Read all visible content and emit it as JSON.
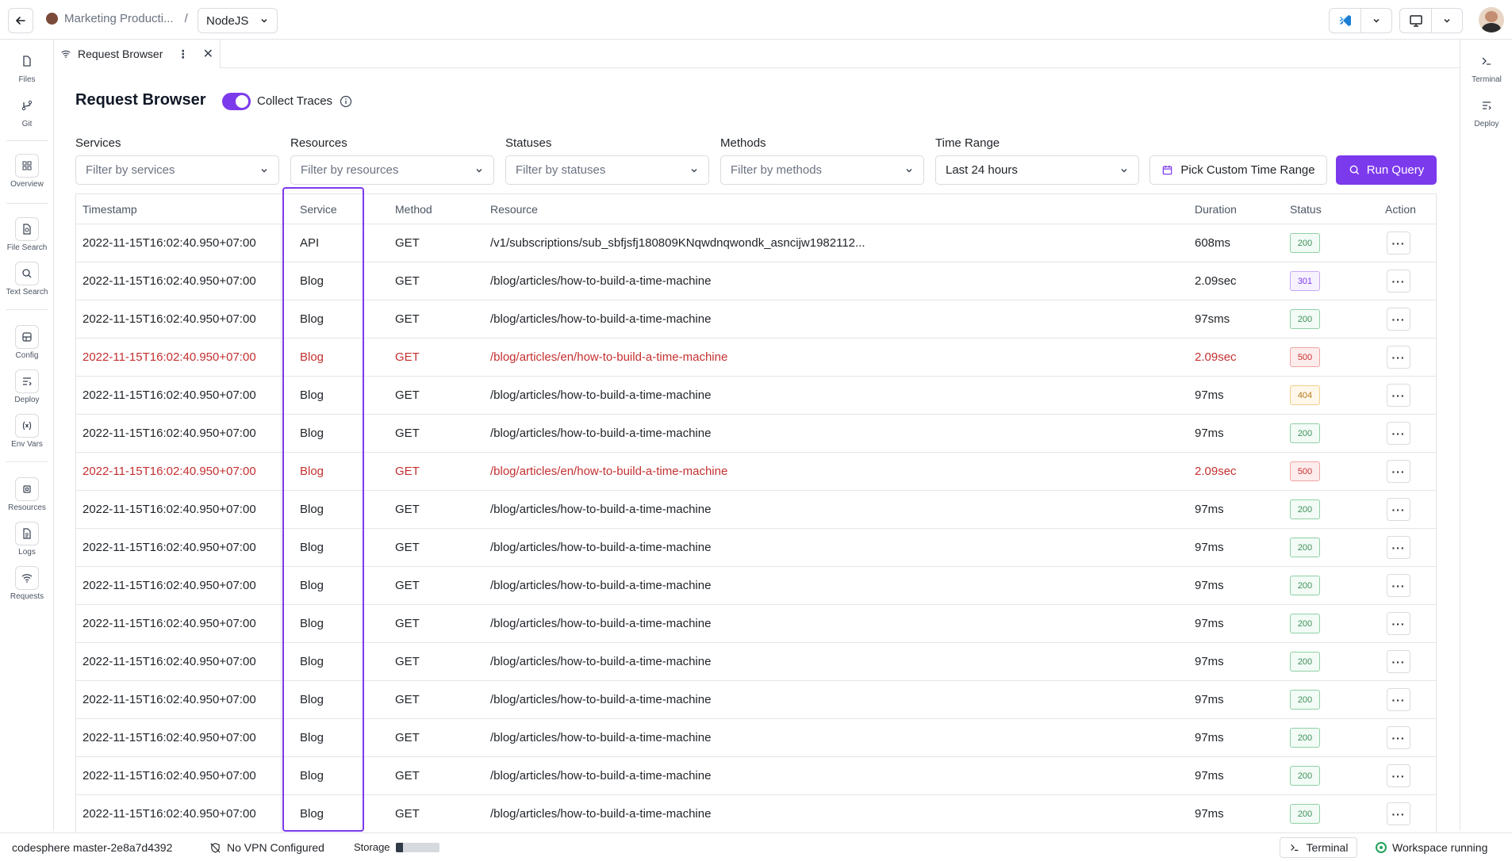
{
  "topbar": {
    "project": "Marketing Producti...",
    "separator": "/",
    "runtime": "NodeJS"
  },
  "left_sidebar": {
    "items": [
      {
        "label": "Files",
        "icon": "file-icon"
      },
      {
        "label": "Git",
        "icon": "git-branch-icon"
      },
      {
        "label": "Overview",
        "icon": "grid-icon"
      },
      {
        "label": "File Search",
        "icon": "file-search-icon"
      },
      {
        "label": "Text Search",
        "icon": "text-search-icon"
      },
      {
        "label": "Config",
        "icon": "config-icon"
      },
      {
        "label": "Deploy",
        "icon": "deploy-icon"
      },
      {
        "label": "Env Vars",
        "icon": "env-vars-icon"
      },
      {
        "label": "Resources",
        "icon": "chip-icon"
      },
      {
        "label": "Logs",
        "icon": "logs-icon"
      },
      {
        "label": "Requests",
        "icon": "wifi-icon"
      }
    ]
  },
  "right_sidebar": {
    "items": [
      {
        "label": "Terminal",
        "icon": "terminal-icon"
      },
      {
        "label": "Deploy",
        "icon": "deploy-icon"
      }
    ]
  },
  "tab": {
    "label": "Request Browser",
    "menu": "⋮",
    "close": "✕"
  },
  "header": {
    "title": "Request Browser",
    "collect_traces_label": "Collect Traces",
    "collect_traces_on": true
  },
  "filters": {
    "services": {
      "label": "Services",
      "placeholder": "Filter by services"
    },
    "resources": {
      "label": "Resources",
      "placeholder": "Filter by resources"
    },
    "statuses": {
      "label": "Statuses",
      "placeholder": "Filter by statuses"
    },
    "methods": {
      "label": "Methods",
      "placeholder": "Filter by methods"
    },
    "time_range": {
      "label": "Time Range",
      "value": "Last 24 hours"
    },
    "custom_range_button": "Pick Custom Time Range",
    "run_query_button": "Run Query"
  },
  "table": {
    "columns": [
      "Timestamp",
      "Service",
      "Method",
      "Resource",
      "Duration",
      "Status",
      "Action"
    ],
    "rows": [
      {
        "timestamp": "2022-11-15T16:02:40.950+07:00",
        "service": "API",
        "method": "GET",
        "resource": "/v1/subscriptions/sub_sbfjsfj180809KNqwdnqwondk_asncijw1982112...",
        "duration": "608ms",
        "status": "200",
        "kind": "ok",
        "action": "···"
      },
      {
        "timestamp": "2022-11-15T16:02:40.950+07:00",
        "service": "Blog",
        "method": "GET",
        "resource": "/blog/articles/how-to-build-a-time-machine",
        "duration": "2.09sec",
        "status": "301",
        "kind": "redir",
        "action": "···"
      },
      {
        "timestamp": "2022-11-15T16:02:40.950+07:00",
        "service": "Blog",
        "method": "GET",
        "resource": "/blog/articles/how-to-build-a-time-machine",
        "duration": "97sms",
        "status": "200",
        "kind": "ok",
        "action": "···"
      },
      {
        "timestamp": "2022-11-15T16:02:40.950+07:00",
        "service": "Blog",
        "method": "GET",
        "resource": "/blog/articles/en/how-to-build-a-time-machine",
        "duration": "2.09sec",
        "status": "500",
        "kind": "err",
        "action": "···"
      },
      {
        "timestamp": "2022-11-15T16:02:40.950+07:00",
        "service": "Blog",
        "method": "GET",
        "resource": "/blog/articles/how-to-build-a-time-machine",
        "duration": "97ms",
        "status": "404",
        "kind": "warn",
        "action": "···"
      },
      {
        "timestamp": "2022-11-15T16:02:40.950+07:00",
        "service": "Blog",
        "method": "GET",
        "resource": "/blog/articles/how-to-build-a-time-machine",
        "duration": "97ms",
        "status": "200",
        "kind": "ok",
        "action": "···"
      },
      {
        "timestamp": "2022-11-15T16:02:40.950+07:00",
        "service": "Blog",
        "method": "GET",
        "resource": "/blog/articles/en/how-to-build-a-time-machine",
        "duration": "2.09sec",
        "status": "500",
        "kind": "err",
        "action": "···"
      },
      {
        "timestamp": "2022-11-15T16:02:40.950+07:00",
        "service": "Blog",
        "method": "GET",
        "resource": "/blog/articles/how-to-build-a-time-machine",
        "duration": "97ms",
        "status": "200",
        "kind": "ok",
        "action": "···"
      },
      {
        "timestamp": "2022-11-15T16:02:40.950+07:00",
        "service": "Blog",
        "method": "GET",
        "resource": "/blog/articles/how-to-build-a-time-machine",
        "duration": "97ms",
        "status": "200",
        "kind": "ok",
        "action": "···"
      },
      {
        "timestamp": "2022-11-15T16:02:40.950+07:00",
        "service": "Blog",
        "method": "GET",
        "resource": "/blog/articles/how-to-build-a-time-machine",
        "duration": "97ms",
        "status": "200",
        "kind": "ok",
        "action": "···"
      },
      {
        "timestamp": "2022-11-15T16:02:40.950+07:00",
        "service": "Blog",
        "method": "GET",
        "resource": "/blog/articles/how-to-build-a-time-machine",
        "duration": "97ms",
        "status": "200",
        "kind": "ok",
        "action": "···"
      },
      {
        "timestamp": "2022-11-15T16:02:40.950+07:00",
        "service": "Blog",
        "method": "GET",
        "resource": "/blog/articles/how-to-build-a-time-machine",
        "duration": "97ms",
        "status": "200",
        "kind": "ok",
        "action": "···"
      },
      {
        "timestamp": "2022-11-15T16:02:40.950+07:00",
        "service": "Blog",
        "method": "GET",
        "resource": "/blog/articles/how-to-build-a-time-machine",
        "duration": "97ms",
        "status": "200",
        "kind": "ok",
        "action": "···"
      },
      {
        "timestamp": "2022-11-15T16:02:40.950+07:00",
        "service": "Blog",
        "method": "GET",
        "resource": "/blog/articles/how-to-build-a-time-machine",
        "duration": "97ms",
        "status": "200",
        "kind": "ok",
        "action": "···"
      },
      {
        "timestamp": "2022-11-15T16:02:40.950+07:00",
        "service": "Blog",
        "method": "GET",
        "resource": "/blog/articles/how-to-build-a-time-machine",
        "duration": "97ms",
        "status": "200",
        "kind": "ok",
        "action": "···"
      },
      {
        "timestamp": "2022-11-15T16:02:40.950+07:00",
        "service": "Blog",
        "method": "GET",
        "resource": "/blog/articles/how-to-build-a-time-machine",
        "duration": "97ms",
        "status": "200",
        "kind": "ok",
        "action": "···"
      }
    ]
  },
  "statusbar": {
    "branch": "codesphere master-2e8a7d4392",
    "vpn": "No VPN Configured",
    "storage_label": "Storage",
    "storage_used": 0.18,
    "terminal_button": "Terminal",
    "workspace_status": "Workspace running"
  },
  "colors": {
    "accent": "#7c3aed",
    "error": "#c53030",
    "success": "#22a35a"
  }
}
